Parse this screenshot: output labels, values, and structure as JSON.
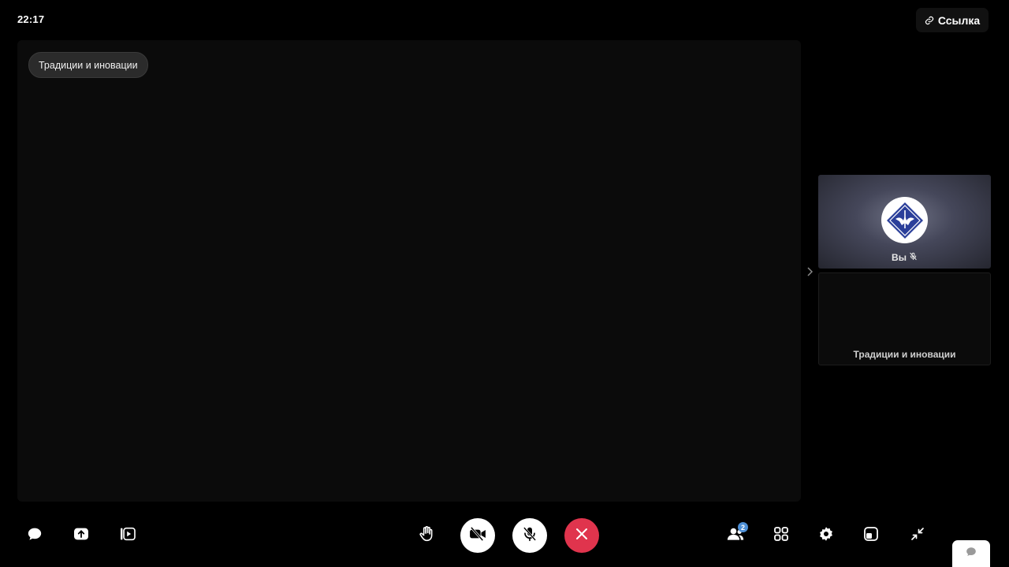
{
  "header": {
    "clock": "22:17",
    "link_button_label": "Ссылка"
  },
  "stage": {
    "label": "Традиции и иновации"
  },
  "participants": {
    "self": {
      "name": "Вы",
      "muted": true
    },
    "other": {
      "name": "Традиции и иновации"
    },
    "count": "2"
  },
  "icons": {
    "left": [
      "chat-icon",
      "upload-icon",
      "presentation-icon"
    ],
    "center": [
      "raise-hand-icon",
      "camera-off-icon",
      "mic-off-icon",
      "hang-up-icon"
    ],
    "right": [
      "participants-icon",
      "grid-layout-icon",
      "settings-icon",
      "pip-icon",
      "exit-fullscreen-icon"
    ],
    "corner": "chat-bubble-icon"
  },
  "colors": {
    "background": "#000000",
    "stage": "#0b0b0b",
    "hang_up": "#e0344d",
    "badge": "#4d8fd6",
    "avatar_logo": "#2b3f9a"
  }
}
